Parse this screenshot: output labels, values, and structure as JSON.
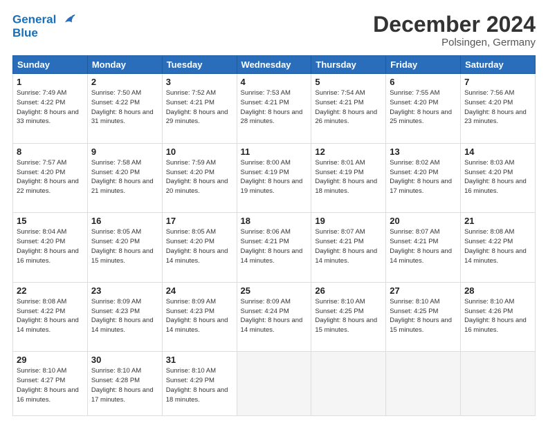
{
  "header": {
    "logo_line1": "General",
    "logo_line2": "Blue",
    "month": "December 2024",
    "location": "Polsingen, Germany"
  },
  "weekdays": [
    "Sunday",
    "Monday",
    "Tuesday",
    "Wednesday",
    "Thursday",
    "Friday",
    "Saturday"
  ],
  "weeks": [
    [
      {
        "day": 1,
        "sunrise": "7:49 AM",
        "sunset": "4:22 PM",
        "daylight": "8 hours and 33 minutes."
      },
      {
        "day": 2,
        "sunrise": "7:50 AM",
        "sunset": "4:22 PM",
        "daylight": "8 hours and 31 minutes."
      },
      {
        "day": 3,
        "sunrise": "7:52 AM",
        "sunset": "4:21 PM",
        "daylight": "8 hours and 29 minutes."
      },
      {
        "day": 4,
        "sunrise": "7:53 AM",
        "sunset": "4:21 PM",
        "daylight": "8 hours and 28 minutes."
      },
      {
        "day": 5,
        "sunrise": "7:54 AM",
        "sunset": "4:21 PM",
        "daylight": "8 hours and 26 minutes."
      },
      {
        "day": 6,
        "sunrise": "7:55 AM",
        "sunset": "4:20 PM",
        "daylight": "8 hours and 25 minutes."
      },
      {
        "day": 7,
        "sunrise": "7:56 AM",
        "sunset": "4:20 PM",
        "daylight": "8 hours and 23 minutes."
      }
    ],
    [
      {
        "day": 8,
        "sunrise": "7:57 AM",
        "sunset": "4:20 PM",
        "daylight": "8 hours and 22 minutes."
      },
      {
        "day": 9,
        "sunrise": "7:58 AM",
        "sunset": "4:20 PM",
        "daylight": "8 hours and 21 minutes."
      },
      {
        "day": 10,
        "sunrise": "7:59 AM",
        "sunset": "4:20 PM",
        "daylight": "8 hours and 20 minutes."
      },
      {
        "day": 11,
        "sunrise": "8:00 AM",
        "sunset": "4:19 PM",
        "daylight": "8 hours and 19 minutes."
      },
      {
        "day": 12,
        "sunrise": "8:01 AM",
        "sunset": "4:19 PM",
        "daylight": "8 hours and 18 minutes."
      },
      {
        "day": 13,
        "sunrise": "8:02 AM",
        "sunset": "4:20 PM",
        "daylight": "8 hours and 17 minutes."
      },
      {
        "day": 14,
        "sunrise": "8:03 AM",
        "sunset": "4:20 PM",
        "daylight": "8 hours and 16 minutes."
      }
    ],
    [
      {
        "day": 15,
        "sunrise": "8:04 AM",
        "sunset": "4:20 PM",
        "daylight": "8 hours and 16 minutes."
      },
      {
        "day": 16,
        "sunrise": "8:05 AM",
        "sunset": "4:20 PM",
        "daylight": "8 hours and 15 minutes."
      },
      {
        "day": 17,
        "sunrise": "8:05 AM",
        "sunset": "4:20 PM",
        "daylight": "8 hours and 14 minutes."
      },
      {
        "day": 18,
        "sunrise": "8:06 AM",
        "sunset": "4:21 PM",
        "daylight": "8 hours and 14 minutes."
      },
      {
        "day": 19,
        "sunrise": "8:07 AM",
        "sunset": "4:21 PM",
        "daylight": "8 hours and 14 minutes."
      },
      {
        "day": 20,
        "sunrise": "8:07 AM",
        "sunset": "4:21 PM",
        "daylight": "8 hours and 14 minutes."
      },
      {
        "day": 21,
        "sunrise": "8:08 AM",
        "sunset": "4:22 PM",
        "daylight": "8 hours and 14 minutes."
      }
    ],
    [
      {
        "day": 22,
        "sunrise": "8:08 AM",
        "sunset": "4:22 PM",
        "daylight": "8 hours and 14 minutes."
      },
      {
        "day": 23,
        "sunrise": "8:09 AM",
        "sunset": "4:23 PM",
        "daylight": "8 hours and 14 minutes."
      },
      {
        "day": 24,
        "sunrise": "8:09 AM",
        "sunset": "4:23 PM",
        "daylight": "8 hours and 14 minutes."
      },
      {
        "day": 25,
        "sunrise": "8:09 AM",
        "sunset": "4:24 PM",
        "daylight": "8 hours and 14 minutes."
      },
      {
        "day": 26,
        "sunrise": "8:10 AM",
        "sunset": "4:25 PM",
        "daylight": "8 hours and 15 minutes."
      },
      {
        "day": 27,
        "sunrise": "8:10 AM",
        "sunset": "4:25 PM",
        "daylight": "8 hours and 15 minutes."
      },
      {
        "day": 28,
        "sunrise": "8:10 AM",
        "sunset": "4:26 PM",
        "daylight": "8 hours and 16 minutes."
      }
    ],
    [
      {
        "day": 29,
        "sunrise": "8:10 AM",
        "sunset": "4:27 PM",
        "daylight": "8 hours and 16 minutes."
      },
      {
        "day": 30,
        "sunrise": "8:10 AM",
        "sunset": "4:28 PM",
        "daylight": "8 hours and 17 minutes."
      },
      {
        "day": 31,
        "sunrise": "8:10 AM",
        "sunset": "4:29 PM",
        "daylight": "8 hours and 18 minutes."
      },
      null,
      null,
      null,
      null
    ]
  ]
}
